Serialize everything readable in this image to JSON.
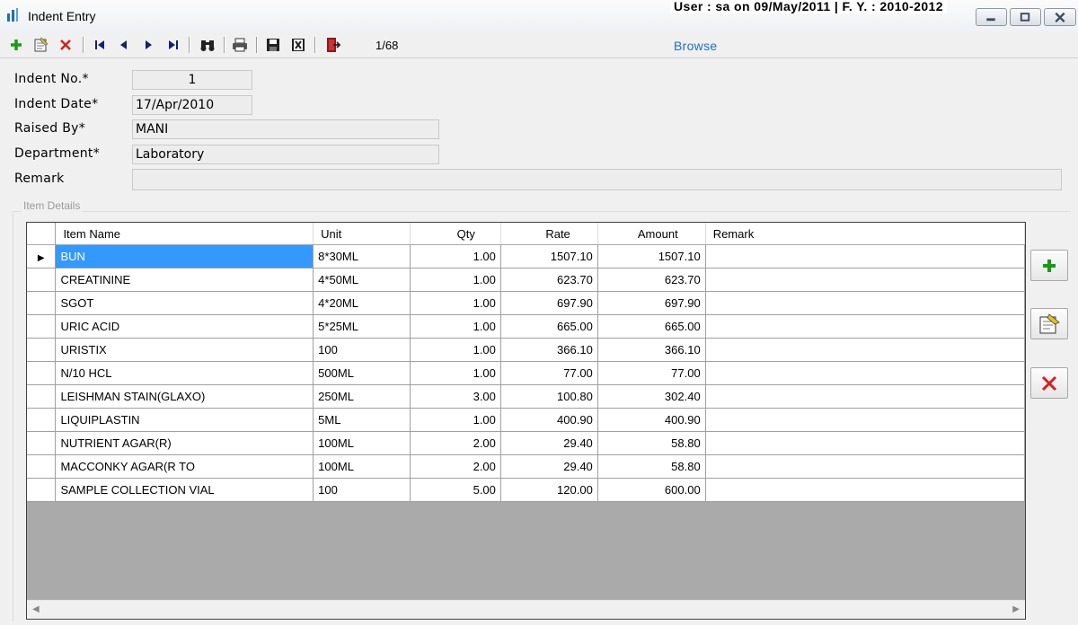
{
  "window": {
    "title": "Indent Entry",
    "user_info": "User : sa on 09/May/2011 | F. Y. : 2010-2012"
  },
  "toolbar": {
    "record_counter": "1/68",
    "browse_label": "Browse",
    "icons": [
      "add-icon",
      "edit-icon",
      "delete-icon",
      "first-record-icon",
      "previous-record-icon",
      "next-record-icon",
      "last-record-icon",
      "find-icon",
      "print-icon",
      "save-icon",
      "cancel-icon",
      "exit-icon"
    ]
  },
  "form": {
    "indent_no_label": "Indent No.*",
    "indent_no": "1",
    "indent_date_label": "Indent Date*",
    "indent_date": "17/Apr/2010",
    "raised_by_label": "Raised By*",
    "raised_by": "MANI",
    "department_label": "Department*",
    "department": "Laboratory",
    "remark_label": "Remark",
    "remark": ""
  },
  "items": {
    "group_label": "Item Details",
    "columns": [
      "Item Name",
      "Unit",
      "Qty",
      "Rate",
      "Amount",
      "Remark"
    ],
    "rows": [
      {
        "name": "BUN",
        "unit": "8*30ML",
        "qty": "1.00",
        "rate": "1507.10",
        "amount": "1507.10",
        "remark": ""
      },
      {
        "name": "CREATININE",
        "unit": "4*50ML",
        "qty": "1.00",
        "rate": "623.70",
        "amount": "623.70",
        "remark": ""
      },
      {
        "name": "SGOT",
        "unit": "4*20ML",
        "qty": "1.00",
        "rate": "697.90",
        "amount": "697.90",
        "remark": ""
      },
      {
        "name": "URIC ACID",
        "unit": "5*25ML",
        "qty": "1.00",
        "rate": "665.00",
        "amount": "665.00",
        "remark": ""
      },
      {
        "name": "URISTIX",
        "unit": "100",
        "qty": "1.00",
        "rate": "366.10",
        "amount": "366.10",
        "remark": ""
      },
      {
        "name": "N/10 HCL",
        "unit": "500ML",
        "qty": "1.00",
        "rate": "77.00",
        "amount": "77.00",
        "remark": ""
      },
      {
        "name": "LEISHMAN STAIN(GLAXO)",
        "unit": "250ML",
        "qty": "3.00",
        "rate": "100.80",
        "amount": "302.40",
        "remark": ""
      },
      {
        "name": "LIQUIPLASTIN",
        "unit": "5ML",
        "qty": "1.00",
        "rate": "400.90",
        "amount": "400.90",
        "remark": ""
      },
      {
        "name": "NUTRIENT AGAR(R)",
        "unit": "100ML",
        "qty": "2.00",
        "rate": "29.40",
        "amount": "58.80",
        "remark": ""
      },
      {
        "name": "MACCONKY AGAR(R TO",
        "unit": "100ML",
        "qty": "2.00",
        "rate": "29.40",
        "amount": "58.80",
        "remark": ""
      },
      {
        "name": "SAMPLE COLLECTION VIAL",
        "unit": "100",
        "qty": "5.00",
        "rate": "120.00",
        "amount": "600.00",
        "remark": ""
      }
    ],
    "selected_row": 0
  },
  "colors": {
    "selection": "#3399ff",
    "link": "#1e6fc6",
    "add_green": "#1a9a1a",
    "delete_red": "#d42020",
    "grid_empty": "#aaaaaa"
  }
}
